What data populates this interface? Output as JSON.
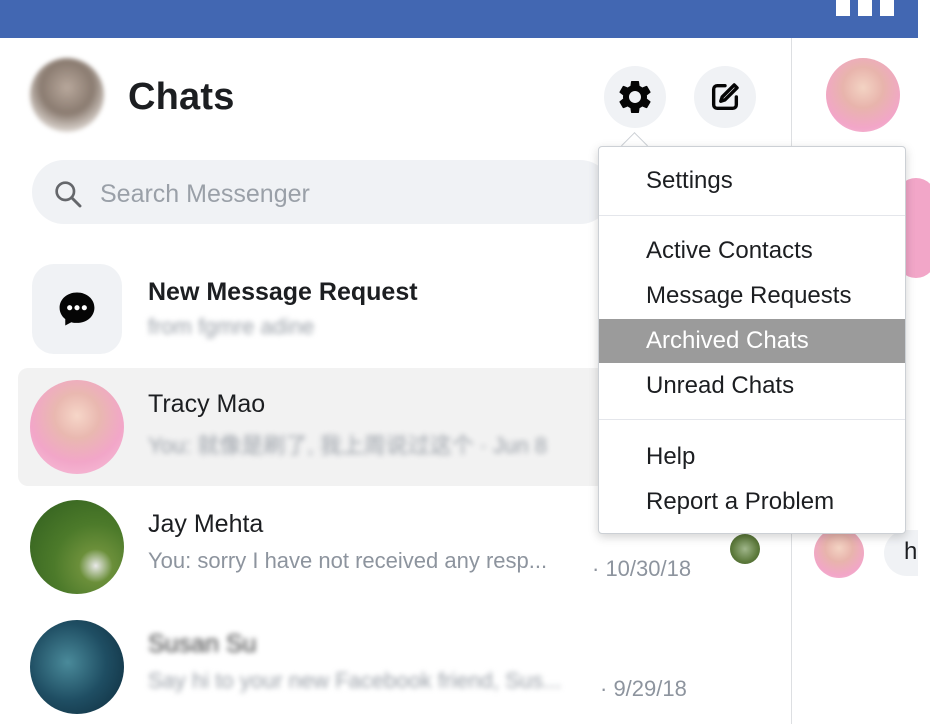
{
  "app": {
    "title": "Chats"
  },
  "search": {
    "placeholder": "Search Messenger"
  },
  "colors": {
    "topbar": "#4267b2",
    "menu_highlight": "#9b9b9b"
  },
  "conversations": [
    {
      "name": "New Message Request",
      "preview": "from fgmre adine",
      "icon": "chat-bubble-icon"
    },
    {
      "name": "Tracy Mao",
      "preview": "You: 就像是刷了, 我上周说过这个 · Jun 8"
    },
    {
      "name": "Jay Mehta",
      "preview": "You: sorry I have not received any resp...",
      "date": "· 10/30/18"
    },
    {
      "name": "Susan Su",
      "preview": "Say hi to your new Facebook friend, Sus...",
      "date": "· 9/29/18"
    }
  ],
  "menu": {
    "items": [
      "Settings",
      "Active Contacts",
      "Message Requests",
      "Archived Chats",
      "Unread Chats",
      "Help",
      "Report a Problem"
    ],
    "highlighted": "Archived Chats"
  },
  "peek": {
    "partial_text": "h"
  },
  "icons": {
    "settings": "gear-icon",
    "compose": "compose-icon",
    "search": "search-icon"
  }
}
